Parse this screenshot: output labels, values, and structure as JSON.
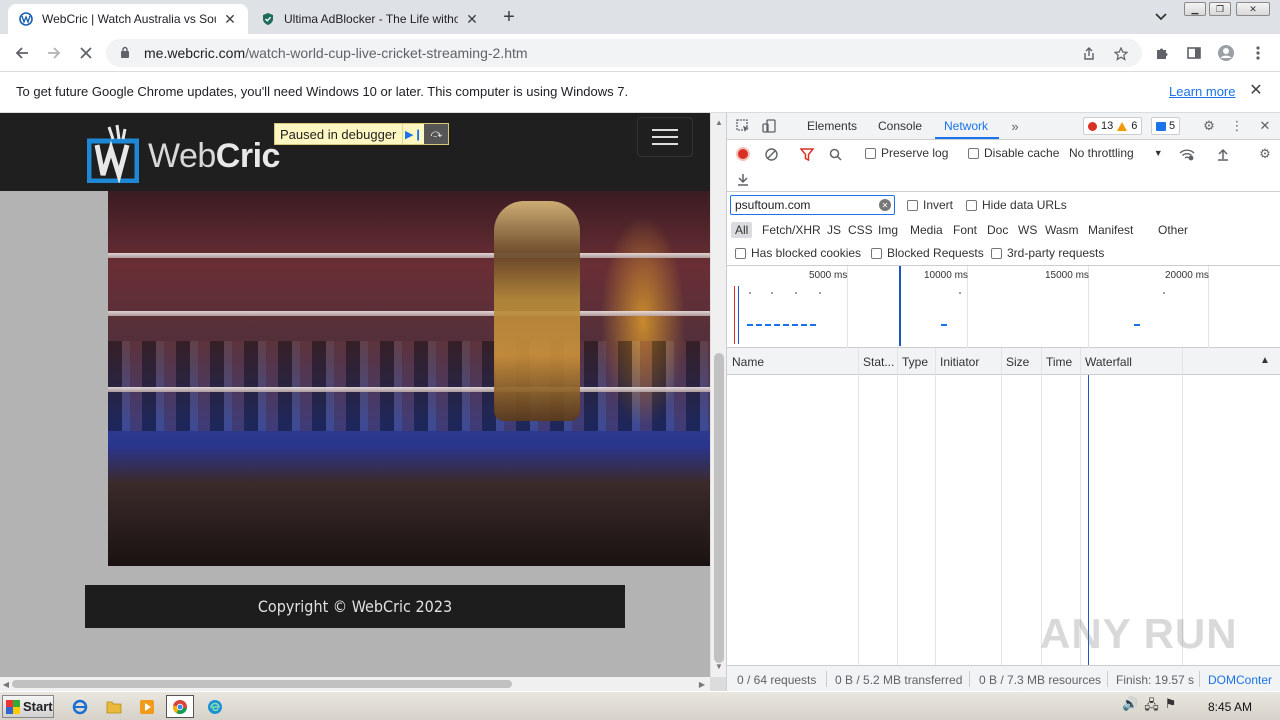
{
  "browser": {
    "tabs": [
      {
        "title": "WebCric | Watch Australia vs South",
        "icon": "webcric-favicon",
        "active": true
      },
      {
        "title": "Ultima AdBlocker - The Life without A",
        "icon": "shield-icon",
        "active": false
      }
    ],
    "url_host": "me.webcric.com",
    "url_path": "/watch-world-cup-live-cricket-streaming-2.htm"
  },
  "infobar": {
    "message": "To get future Google Chrome updates, you'll need Windows 10 or later. This computer is using Windows 7.",
    "learn_more": "Learn more"
  },
  "page": {
    "logo_text_a": "Web",
    "logo_text_b": "Cric",
    "debugger_label": "Paused in debugger",
    "copyright": "Copyright © WebCric 2023"
  },
  "devtools": {
    "tabs": [
      "Elements",
      "Console",
      "Network"
    ],
    "active_tab": "Network",
    "error_count": "13",
    "warning_count": "6",
    "message_count": "5",
    "preserve_log": "Preserve log",
    "disable_cache": "Disable cache",
    "throttling": "No throttling",
    "filter_value": "psuftoum.com",
    "invert": "Invert",
    "hide_data_urls": "Hide data URLs",
    "type_filters": [
      "All",
      "Fetch/XHR",
      "JS",
      "CSS",
      "Img",
      "Media",
      "Font",
      "Doc",
      "WS",
      "Wasm",
      "Manifest",
      "Other"
    ],
    "has_blocked_cookies": "Has blocked cookies",
    "blocked_requests": "Blocked Requests",
    "third_party": "3rd-party requests",
    "overview_ticks": [
      "5000 ms",
      "10000 ms",
      "15000 ms",
      "20000 ms"
    ],
    "columns": [
      "Name",
      "Stat...",
      "Type",
      "Initiator",
      "Size",
      "Time",
      "Waterfall"
    ],
    "status": {
      "requests": "0 / 64 requests",
      "transferred": "0 B / 5.2 MB transferred",
      "resources": "0 B / 7.3 MB resources",
      "finish": "Finish: 19.57 s",
      "domcontent": "DOMConter"
    }
  },
  "watermark": "ANY RUN",
  "taskbar": {
    "start_label": "Start",
    "clock": "8:45 AM"
  }
}
